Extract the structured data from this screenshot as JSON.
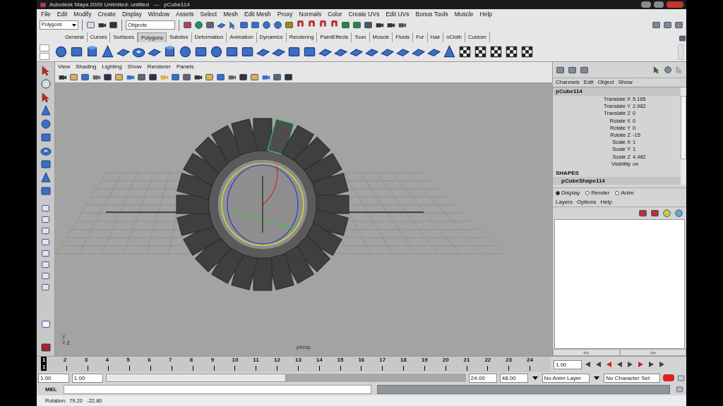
{
  "window": {
    "title": "Autodesk Maya 2009 Unlimited: untitled   ---   pCube114"
  },
  "menu": [
    "File",
    "Edit",
    "Modify",
    "Create",
    "Display",
    "Window",
    "Assets",
    "Select",
    "Mesh",
    "Edit Mesh",
    "Proxy",
    "Normals",
    "Color",
    "Create UVs",
    "Edit UVs",
    "Bonus Tools",
    "Muscle",
    "Help"
  ],
  "status_line": {
    "menu_set": "Polygons",
    "selection_field": "Objects"
  },
  "shelf_tabs": [
    {
      "label": "General",
      "selected": false
    },
    {
      "label": "Curves",
      "selected": false
    },
    {
      "label": "Surfaces",
      "selected": false
    },
    {
      "label": "Polygons",
      "selected": true
    },
    {
      "label": "Subdivs",
      "selected": false
    },
    {
      "label": "Deformation",
      "selected": false
    },
    {
      "label": "Animation",
      "selected": false
    },
    {
      "label": "Dynamics",
      "selected": false
    },
    {
      "label": "Rendering",
      "selected": false
    },
    {
      "label": "PaintEffects",
      "selected": false
    },
    {
      "label": "Toon",
      "selected": false
    },
    {
      "label": "Muscle",
      "selected": false
    },
    {
      "label": "Fluids",
      "selected": false
    },
    {
      "label": "Fur",
      "selected": false
    },
    {
      "label": "Hair",
      "selected": false
    },
    {
      "label": "nCloth",
      "selected": false
    },
    {
      "label": "Custom",
      "selected": false
    }
  ],
  "viewport": {
    "menu": [
      "View",
      "Shading",
      "Lighting",
      "Show",
      "Renderer",
      "Panels"
    ],
    "camera": "persp",
    "axis_labels": [
      "y",
      "x",
      "z"
    ]
  },
  "channel_box": {
    "menu": [
      "Channels",
      "Edit",
      "Object",
      "Show"
    ],
    "object": "pCube114",
    "attributes": [
      {
        "label": "Translate X",
        "value": "5.165"
      },
      {
        "label": "Translate Y",
        "value": "2.982"
      },
      {
        "label": "Translate Z",
        "value": "0"
      },
      {
        "label": "Rotate X",
        "value": "0"
      },
      {
        "label": "Rotate Y",
        "value": "0"
      },
      {
        "label": "Rotate Z",
        "value": "-15"
      },
      {
        "label": "Scale X",
        "value": "1"
      },
      {
        "label": "Scale Y",
        "value": "1"
      },
      {
        "label": "Scale Z",
        "value": "4.482"
      },
      {
        "label": "Visibility",
        "value": "on"
      }
    ],
    "shapes_heading": "SHAPES",
    "shape": "pCubeShape114"
  },
  "layer_editor": {
    "modes": [
      {
        "label": "Display",
        "selected": true
      },
      {
        "label": "Render",
        "selected": false
      },
      {
        "label": "Anim",
        "selected": false
      }
    ],
    "menu": [
      "Layers",
      "Options",
      "Help"
    ],
    "scroll_buttons": [
      "<<",
      ">>"
    ]
  },
  "timeline": {
    "frames": [
      {
        "label": "1",
        "selected": true
      },
      {
        "label": "2",
        "selected": false
      },
      {
        "label": "3",
        "selected": false
      },
      {
        "label": "4",
        "selected": false
      },
      {
        "label": "5",
        "selected": false
      },
      {
        "label": "6",
        "selected": false
      },
      {
        "label": "7",
        "selected": false
      },
      {
        "label": "8",
        "selected": false
      },
      {
        "label": "9",
        "selected": false
      },
      {
        "label": "10",
        "selected": false
      },
      {
        "label": "11",
        "selected": false
      },
      {
        "label": "12",
        "selected": false
      },
      {
        "label": "13",
        "selected": false
      },
      {
        "label": "14",
        "selected": false
      },
      {
        "label": "15",
        "selected": false
      },
      {
        "label": "16",
        "selected": false
      },
      {
        "label": "17",
        "selected": false
      },
      {
        "label": "18",
        "selected": false
      },
      {
        "label": "19",
        "selected": false
      },
      {
        "label": "20",
        "selected": false
      },
      {
        "label": "21",
        "selected": false
      },
      {
        "label": "22",
        "selected": false
      },
      {
        "label": "23",
        "selected": false
      },
      {
        "label": "24",
        "selected": false
      }
    ],
    "current_frame": "1",
    "current_time": "1.00"
  },
  "range": {
    "start": "1.00",
    "playback_start": "1.00",
    "level": 0.5,
    "playback_end": "24.00",
    "end": "48.00",
    "anim_layer": "No Anim Layer",
    "character_set": "No Character Set"
  },
  "command_line": {
    "label": "MEL"
  },
  "help_line": "Rotation:  79.20   -22.80"
}
